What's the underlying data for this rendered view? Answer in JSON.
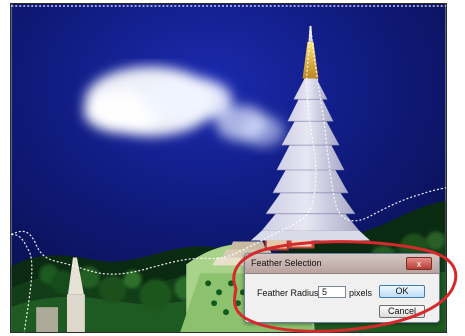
{
  "dialog": {
    "title": "Feather Selection",
    "close_label": "x",
    "label": "Feather Radius:",
    "value": "5",
    "units": "pixels",
    "ok_label": "OK",
    "cancel_label": "Cancel"
  },
  "colors": {
    "sky": "#0f1a7a",
    "annotation": "#d6292b"
  },
  "icons": {
    "close": "close-icon"
  }
}
